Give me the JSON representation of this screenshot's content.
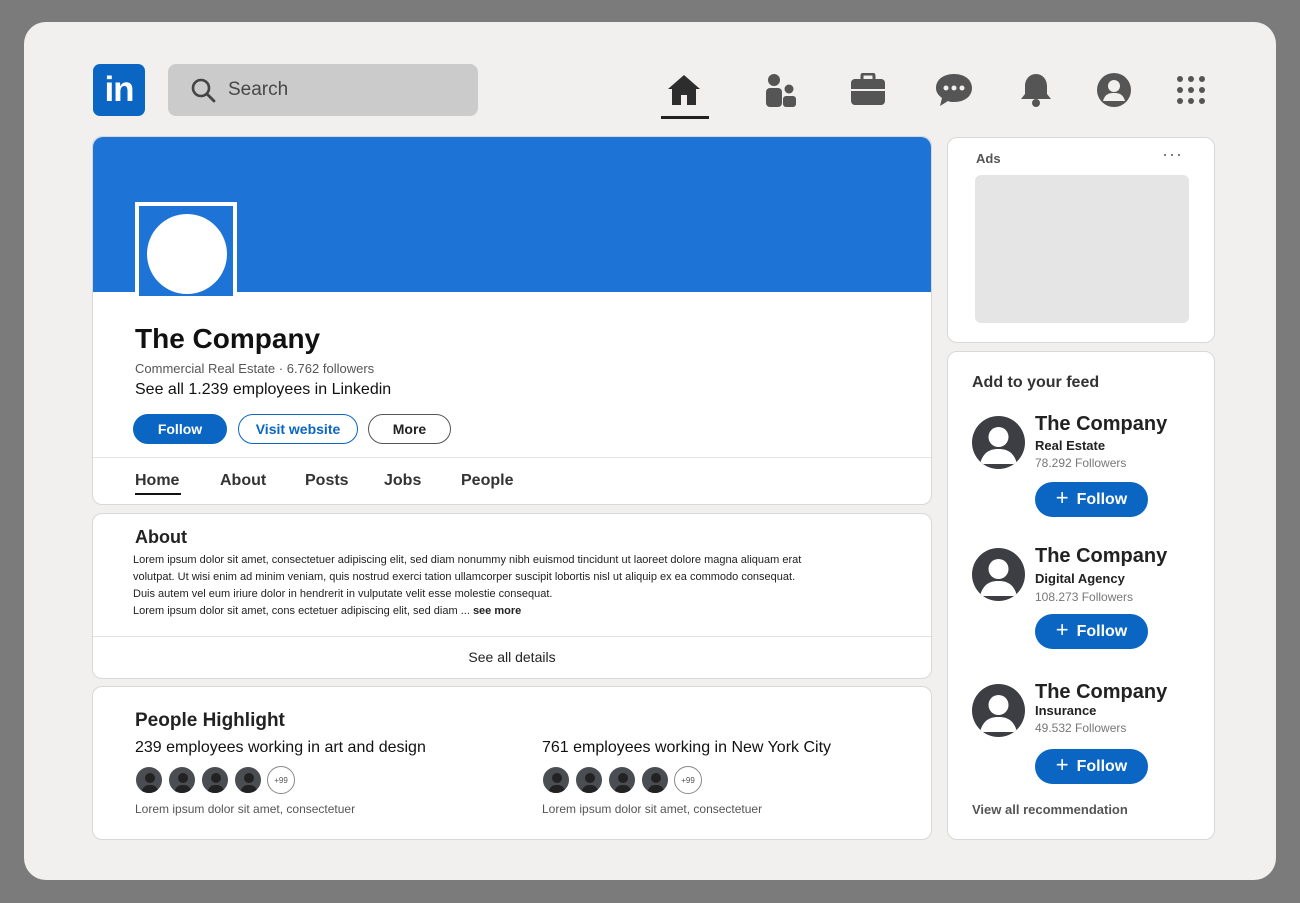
{
  "nav": {
    "logo_text": "in",
    "search_placeholder": "Search",
    "icons": [
      "home-icon",
      "network-icon",
      "jobs-icon",
      "messaging-icon",
      "notifications-icon",
      "me-icon",
      "apps-icon"
    ]
  },
  "profile": {
    "name": "The Company",
    "meta": "Commercial Real Estate · 6.762 followers",
    "employees": "See all 1.239 employees in Linkedin",
    "follow_label": "Follow",
    "visit_label": "Visit website",
    "more_label": "More",
    "tabs": [
      "Home",
      "About",
      "Posts",
      "Jobs",
      "People"
    ]
  },
  "about": {
    "title": "About",
    "lines": [
      "Lorem ipsum dolor sit amet, consectetuer adipiscing elit, sed diam nonummy nibh euismod tincidunt ut laoreet dolore magna aliquam erat",
      "volutpat. Ut wisi enim ad minim veniam, quis nostrud exerci tation ullamcorper suscipit lobortis nisl ut aliquip ex ea commodo consequat.",
      "Duis autem vel eum iriure dolor in hendrerit in vulputate velit esse molestie consequat.",
      "Lorem ipsum dolor sit amet, cons ectetuer adipiscing elit, sed diam ..."
    ],
    "see_more": "see more",
    "see_all": "See all details"
  },
  "people": {
    "title": "People Highlight",
    "groups": [
      {
        "title": "239 employees working in art and design",
        "badge": "+99",
        "caption": "Lorem ipsum dolor sit amet, consectetuer"
      },
      {
        "title": "761 employees working in New York City",
        "badge": "+99",
        "caption": "Lorem ipsum dolor sit amet, consectetuer"
      }
    ]
  },
  "ads": {
    "label": "Ads",
    "menu": "···"
  },
  "feed": {
    "title": "Add to your feed",
    "items": [
      {
        "name": "The Company",
        "industry": "Real Estate",
        "followers": "78.292 Followers",
        "follow": "Follow"
      },
      {
        "name": "The Company",
        "industry": "Digital Agency",
        "followers": "108.273 Followers",
        "follow": "Follow"
      },
      {
        "name": "The Company",
        "industry": "Insurance",
        "followers": "49.532 Followers",
        "follow": "Follow"
      }
    ],
    "view_all": "View all recommendation"
  },
  "colors": {
    "brand": "#0a66c2",
    "banner": "#1e74d6",
    "frame_bg": "#f1f0ee",
    "outer_bg": "#7a7b7a"
  }
}
